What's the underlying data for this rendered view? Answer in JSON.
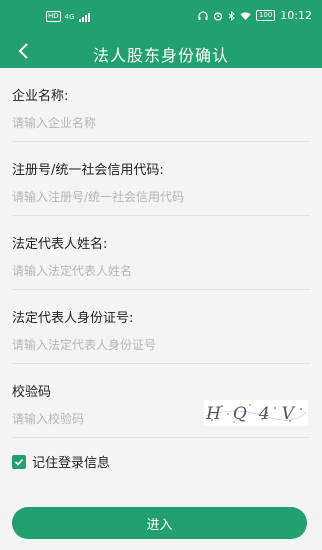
{
  "status_bar": {
    "hd_label": "HD",
    "network_label": "4G",
    "battery_label": "100",
    "time": "10:12"
  },
  "header": {
    "title": "法人股东身份确认",
    "back_icon": "chevron-left-icon"
  },
  "form": {
    "fields": [
      {
        "label": "企业名称:",
        "placeholder": "请输入企业名称",
        "value": ""
      },
      {
        "label": "注册号/统一社会信用代码:",
        "placeholder": "请输入注册号/统一社会信用代码",
        "value": ""
      },
      {
        "label": "法定代表人姓名:",
        "placeholder": "请输入法定代表人姓名",
        "value": ""
      },
      {
        "label": "法定代表人身份证号:",
        "placeholder": "请输入法定代表人身份证号",
        "value": ""
      },
      {
        "label": "校验码",
        "placeholder": "请输入校验码",
        "value": ""
      }
    ],
    "captcha_text": "HQ4V"
  },
  "remember": {
    "label": "记住登录信息",
    "checked": true
  },
  "submit_label": "进入",
  "colors": {
    "primary": "#22a16e",
    "background": "#f4f4f4",
    "placeholder": "#b6b6b6"
  }
}
